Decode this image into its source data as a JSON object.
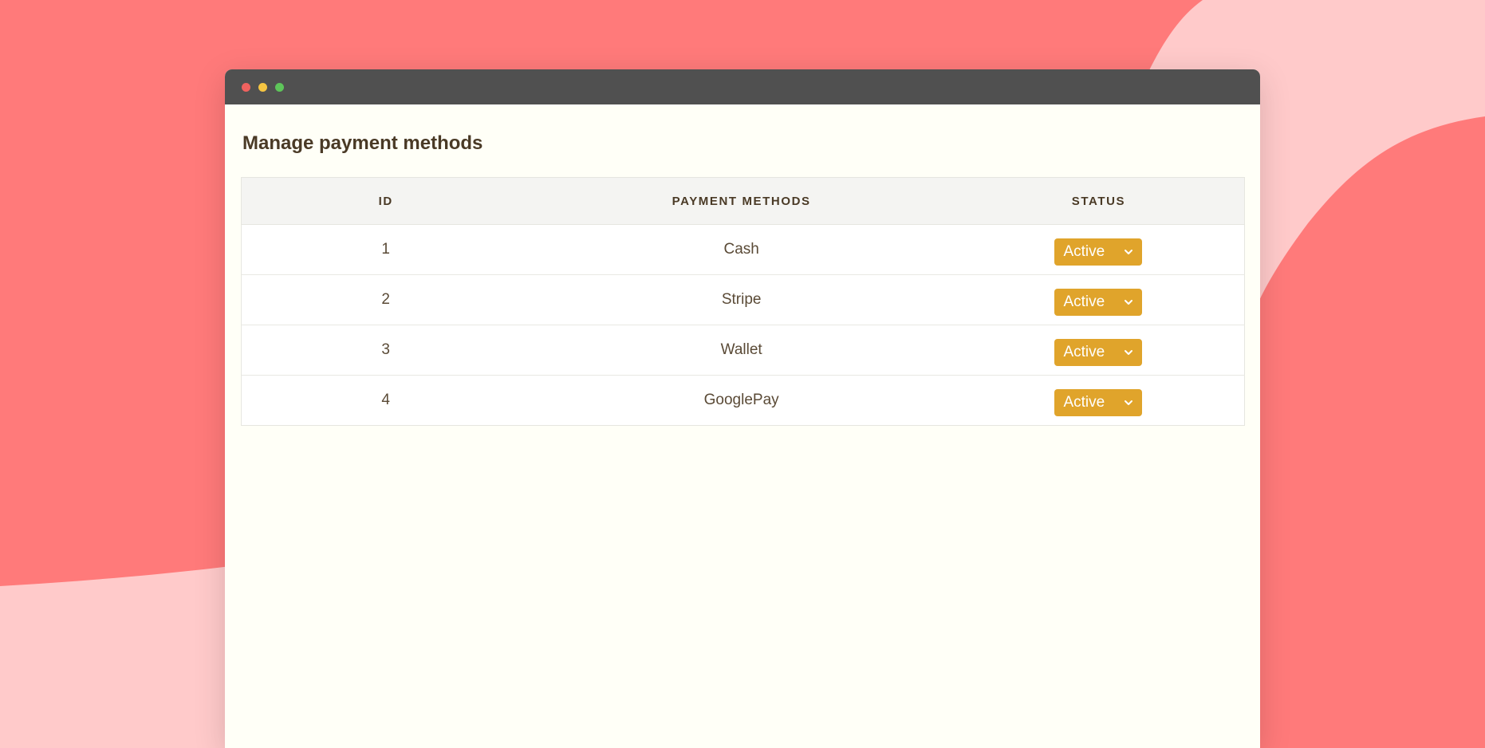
{
  "window": {
    "controls": [
      "close",
      "minimize",
      "maximize"
    ],
    "control_colors": {
      "close": "#f0625f",
      "minimize": "#f5c542",
      "maximize": "#5ec55a"
    }
  },
  "page": {
    "title": "Manage payment methods"
  },
  "table": {
    "headers": {
      "id": "ID",
      "method": "PAYMENT METHODS",
      "status": "STATUS"
    },
    "rows": [
      {
        "id": "1",
        "method": "Cash",
        "status": "Active"
      },
      {
        "id": "2",
        "method": "Stripe",
        "status": "Active"
      },
      {
        "id": "3",
        "method": "Wallet",
        "status": "Active"
      },
      {
        "id": "4",
        "method": "GooglePay",
        "status": "Active"
      }
    ]
  },
  "colors": {
    "background": "#ff7a7a",
    "background_accent": "#ffcaca",
    "titlebar": "#505050",
    "status_active": "#e0a42b",
    "text": "#4a3a26"
  },
  "icons": {
    "status_dropdown": "chevron-down-icon"
  }
}
